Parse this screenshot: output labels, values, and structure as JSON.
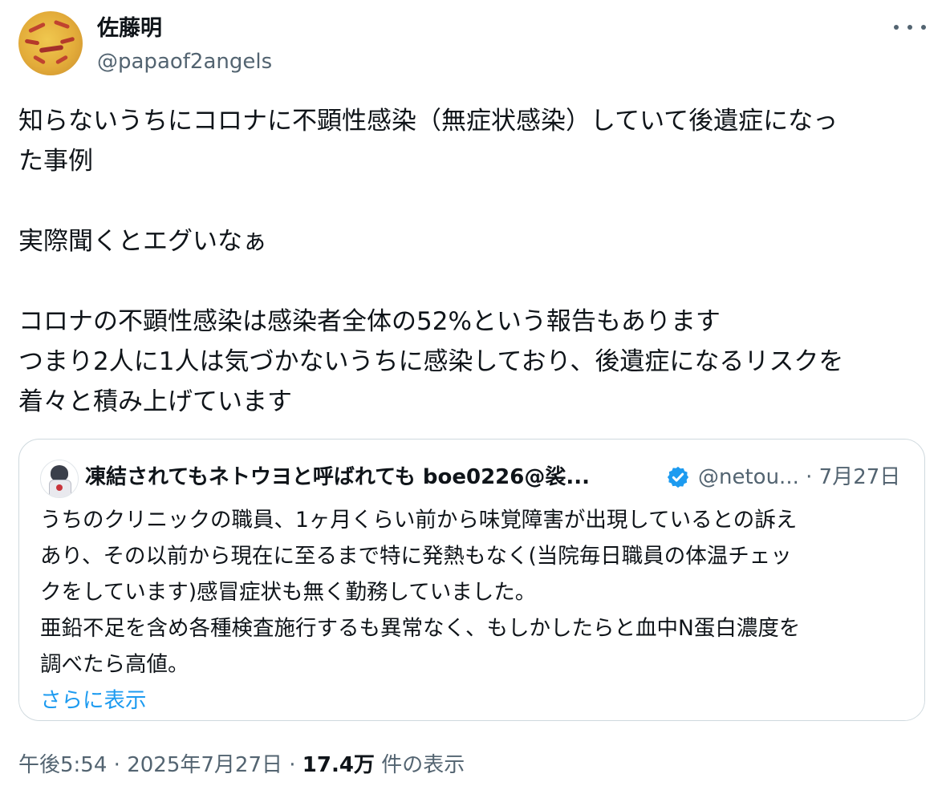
{
  "author": {
    "display_name": "佐藤明",
    "handle": "@papaof2angels"
  },
  "tweet": {
    "lines": [
      "知らないうちにコロナに不顕性感染（無症状感染）していて後遺症になっ",
      "た事例",
      "実際聞くとエグいなぁ",
      "コロナの不顕性感染は感染者全体の52%という報告もあります",
      "つまり2人に1人は気づかないうちに感染しており、後遺症になるリスクを",
      "着々と積み上げています"
    ]
  },
  "quoted_tweet": {
    "display_name": "凍結されてもネトウヨと呼ばれても boe0226@裟...",
    "handle": "@netou...",
    "date": "· 7月27日",
    "verified_badge_color": "#1d9bf0",
    "lines": [
      "うちのクリニックの職員、1ヶ月くらい前から味覚障害が出現しているとの訴え",
      "あり、その以前から現在に至るまで特に発熱もなく(当院毎日職員の体温チェッ",
      "クをしています)感冒症状も無く勤務していました。",
      "亜鉛不足を含め各種検査施行するも異常なく、もしかしたらと血中N蛋白濃度を",
      "調べたら高値。"
    ],
    "show_more": "さらに表示"
  },
  "meta": {
    "time": "午後5:54",
    "date": "2025年7月27日",
    "views_count": "17.4万",
    "views_label": "件の表示"
  },
  "colors": {
    "text": "#0f1419",
    "secondary": "#536471",
    "link": "#1d9bf0",
    "border": "#cfd9de"
  }
}
